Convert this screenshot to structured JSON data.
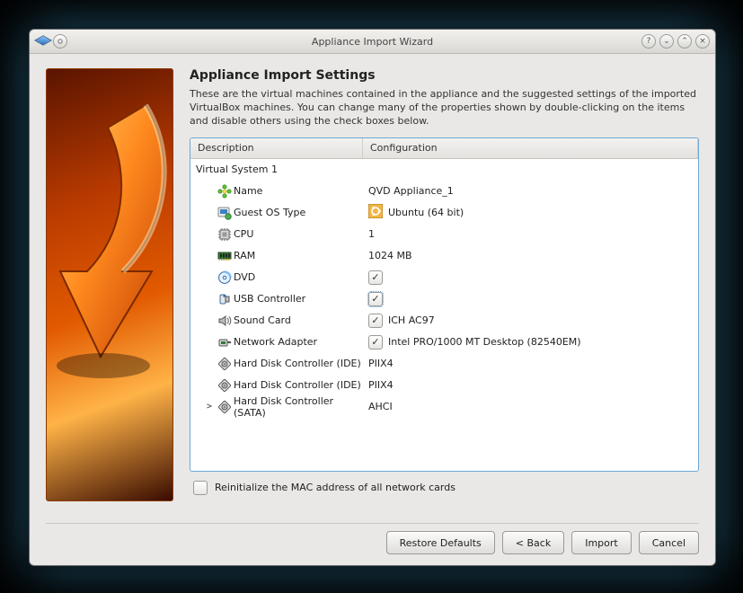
{
  "window": {
    "title": "Appliance Import Wizard"
  },
  "titlebar_buttons": {
    "help": "?",
    "minimize": "⌄",
    "maximize": "⌃",
    "close": "×"
  },
  "main": {
    "heading": "Appliance Import Settings",
    "description": "These are the virtual machines contained in the appliance and the suggested settings of the imported VirtualBox machines. You can change many of the properties shown by double-clicking on the items and disable others using the check boxes below."
  },
  "table": {
    "headers": {
      "description": "Description",
      "configuration": "Configuration"
    },
    "group_label": "Virtual System 1",
    "rows": [
      {
        "icon": "flower",
        "label": "Name",
        "value_text": "QVD Appliance_1"
      },
      {
        "icon": "os",
        "label": "Guest OS Type",
        "value_icon": "ubuntu",
        "value_text": "Ubuntu (64 bit)"
      },
      {
        "icon": "cpu",
        "label": "CPU",
        "value_text": "1"
      },
      {
        "icon": "ram",
        "label": "RAM",
        "value_text": "1024 MB"
      },
      {
        "icon": "disc",
        "label": "DVD",
        "checkbox": true,
        "checked": true
      },
      {
        "icon": "usb",
        "label": "USB Controller",
        "checkbox": true,
        "checked": true,
        "selected": true
      },
      {
        "icon": "sound",
        "label": "Sound Card",
        "checkbox": true,
        "checked": true,
        "value_text": "ICH AC97"
      },
      {
        "icon": "net",
        "label": "Network Adapter",
        "checkbox": true,
        "checked": true,
        "value_text": "Intel PRO/1000 MT Desktop (82540EM)"
      },
      {
        "icon": "hdd",
        "label": "Hard Disk Controller (IDE)",
        "value_text": "PIIX4"
      },
      {
        "icon": "hdd",
        "label": "Hard Disk Controller (IDE)",
        "value_text": "PIIX4"
      },
      {
        "icon": "hdd",
        "label": "Hard Disk Controller (SATA)",
        "value_text": "AHCI",
        "expandable": true
      }
    ]
  },
  "mac_checkbox": {
    "label": "Reinitialize the MAC address of all network cards",
    "checked": false
  },
  "buttons": {
    "restore": "Restore Defaults",
    "back": "< Back",
    "import_btn": "Import",
    "cancel": "Cancel"
  }
}
